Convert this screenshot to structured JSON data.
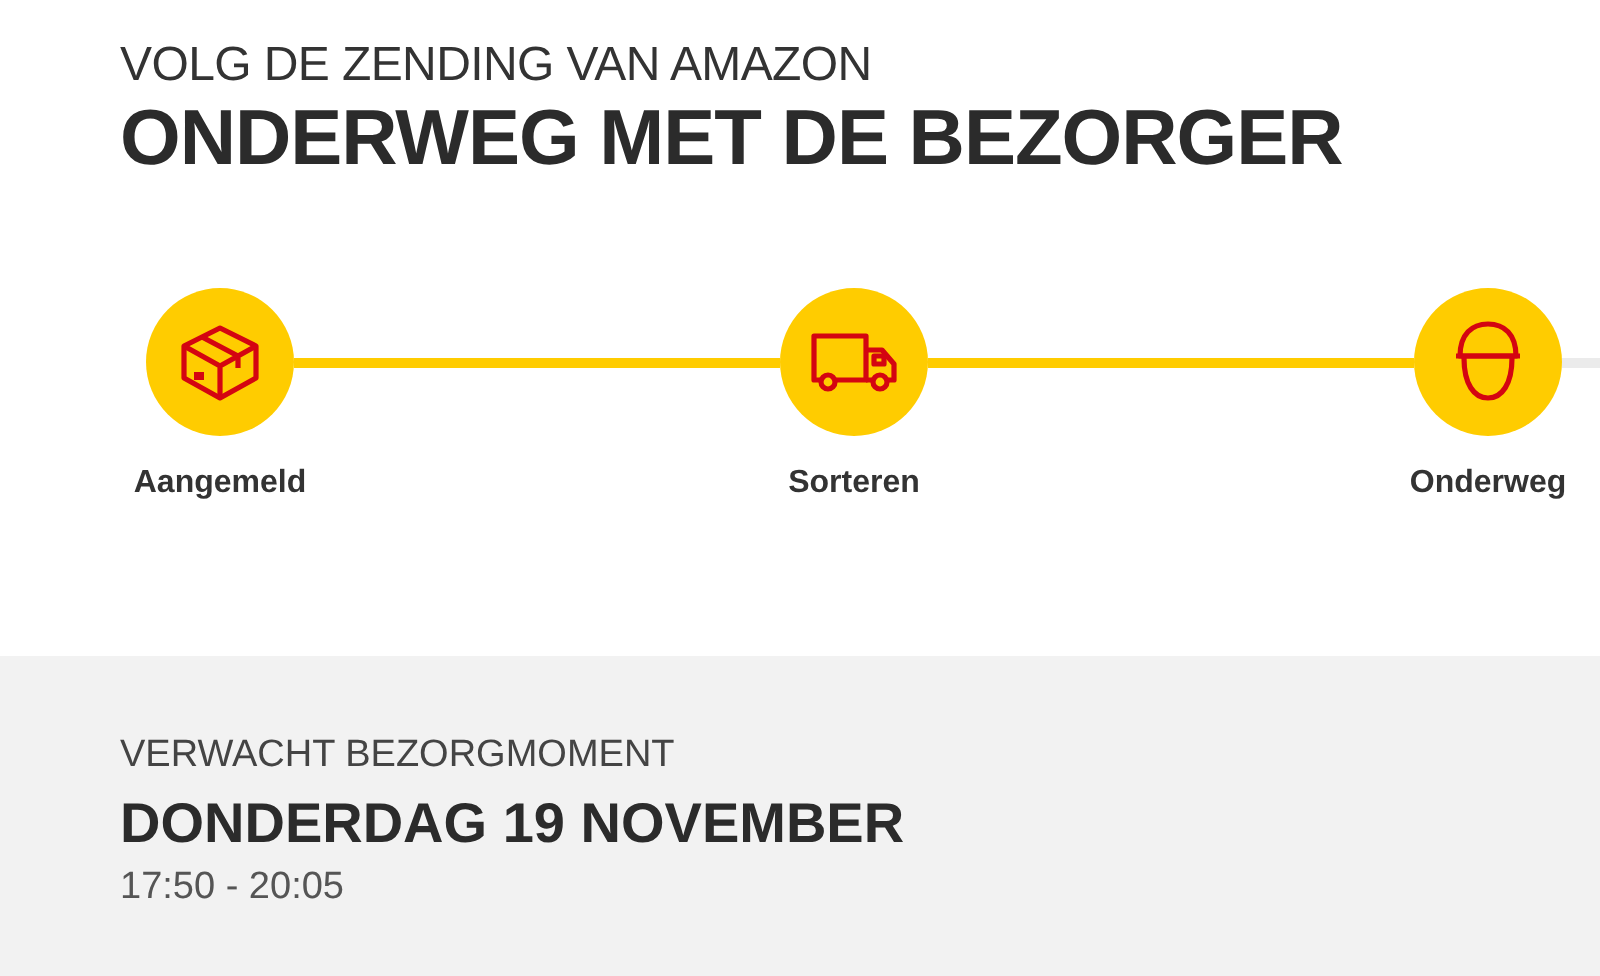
{
  "header": {
    "subtitle": "VOLG DE ZENDING VAN AMAZON",
    "title": "ONDERWEG MET DE BEZORGER"
  },
  "steps": [
    {
      "kind": "box",
      "label": "Aangemeld",
      "reached": true
    },
    {
      "kind": "truck",
      "label": "Sorteren",
      "reached": true
    },
    {
      "kind": "courier",
      "label": "Onderweg",
      "reached": true
    }
  ],
  "trail": {
    "reached": false
  },
  "delivery": {
    "label": "VERWACHT BEZORGMOMENT",
    "date": "DONDERDAG 19 NOVEMBER",
    "time": "17:50 - 20:05"
  }
}
